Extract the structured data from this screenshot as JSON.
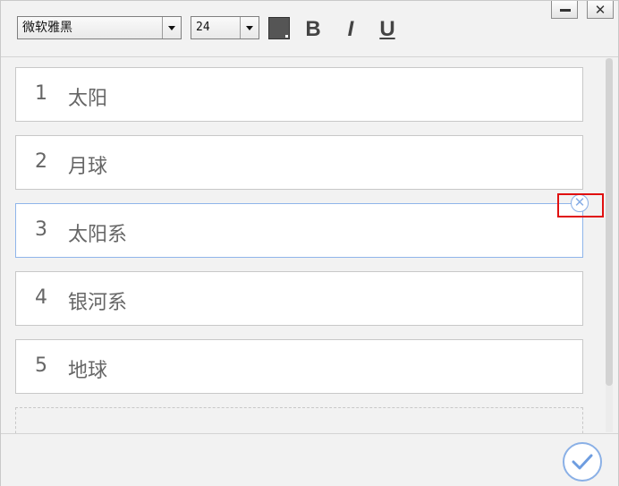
{
  "toolbar": {
    "font_value": "微软雅黑",
    "size_value": "24",
    "color": "#555555",
    "bold_label": "B",
    "italic_label": "I",
    "underline_label": "U"
  },
  "window_controls": {
    "minimize_icon": "minimize-icon",
    "close_label": "✕"
  },
  "items": [
    {
      "number": "1",
      "label": "太阳"
    },
    {
      "number": "2",
      "label": "月球"
    },
    {
      "number": "3",
      "label": "太阳系"
    },
    {
      "number": "4",
      "label": "银河系"
    },
    {
      "number": "5",
      "label": "地球"
    }
  ],
  "delete_icon": "⊗",
  "colors": {
    "accent": "#8ab0e6",
    "highlight": "#e01010"
  }
}
